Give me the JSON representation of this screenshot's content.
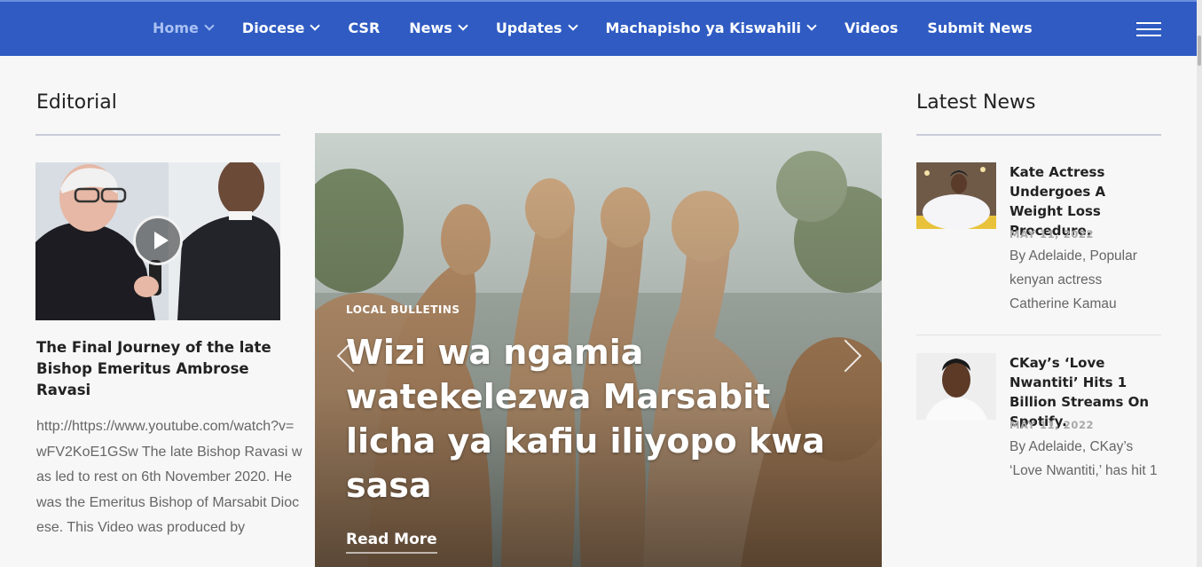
{
  "nav": {
    "items": [
      {
        "label": "Home",
        "dropdown": true,
        "active": true
      },
      {
        "label": "Diocese",
        "dropdown": true
      },
      {
        "label": "CSR",
        "dropdown": false
      },
      {
        "label": "News",
        "dropdown": true
      },
      {
        "label": "Updates",
        "dropdown": true
      },
      {
        "label": "Machapisho ya Kiswahili",
        "dropdown": true
      },
      {
        "label": "Videos",
        "dropdown": false
      },
      {
        "label": "Submit News",
        "dropdown": false
      }
    ],
    "menu_icon": "hamburger-menu-icon",
    "bg_color": "#2f5bc2"
  },
  "editorial": {
    "heading": "Editorial",
    "post": {
      "title": "The Final Journey of the late Bishop Emeritus Ambrose Ravasi",
      "body": "http://https://www.youtube.com/watch?v=wFV2KoE1GSw The late Bishop Ravasi was led to rest on 6th November 2020. He was the Emeritus Bishop of Marsabit Diocese. This Video was produced by",
      "media_icon": "play-icon"
    }
  },
  "slider": {
    "category": "LOCAL BULLETINS",
    "title": "Wizi wa ngamia watekelezwa Marsabit licha ya kafiu iliyopo kwa sasa",
    "read_more": "Read More"
  },
  "latest_news": {
    "heading": "Latest News",
    "items": [
      {
        "title": "Kate Actress Undergoes A Weight Loss Procedure.",
        "date": "MAY 11, 2022",
        "excerpt": "By Adelaide, Popular kenyan actress Catherine Kamau"
      },
      {
        "title": "CKay’s ‘Love Nwantiti’ Hits 1 Billion Streams On Spotify.",
        "date": "MAY 11, 2022",
        "excerpt": "By Adelaide, CKay’s ‘Love Nwantiti,’ has hit 1"
      }
    ]
  }
}
